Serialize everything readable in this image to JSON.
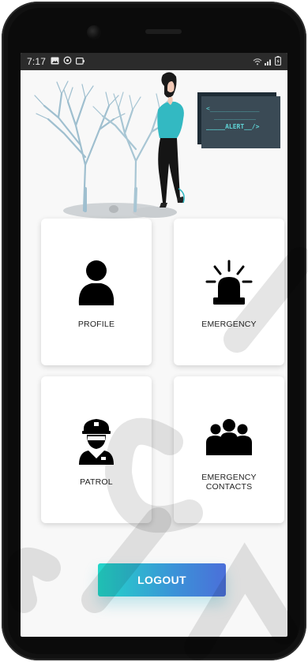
{
  "status": {
    "time": "7:17",
    "left_icons": [
      "image-icon",
      "settings-icon",
      "cast-icon"
    ],
    "right_icons": [
      "wifi-icon",
      "signal-icon",
      "battery-icon"
    ]
  },
  "hero": {
    "alert_line1": "<_____________",
    "alert_line2": "___________",
    "alert_line3": "_____ALERT__/>"
  },
  "cards": [
    {
      "label": "PROFILE",
      "icon": "user-icon"
    },
    {
      "label": "EMERGENCY",
      "icon": "siren-icon"
    },
    {
      "label": "PATROL",
      "icon": "police-officer-icon"
    },
    {
      "label": "EMERGENCY CONTACTS",
      "icon": "group-icon"
    }
  ],
  "logout_label": "LOGOUT",
  "colors": {
    "accent_start": "#23d6c8",
    "accent_end": "#4b6fd9",
    "screen_bg": "#f8f8f8",
    "status_bar": "#2b2b2b"
  }
}
